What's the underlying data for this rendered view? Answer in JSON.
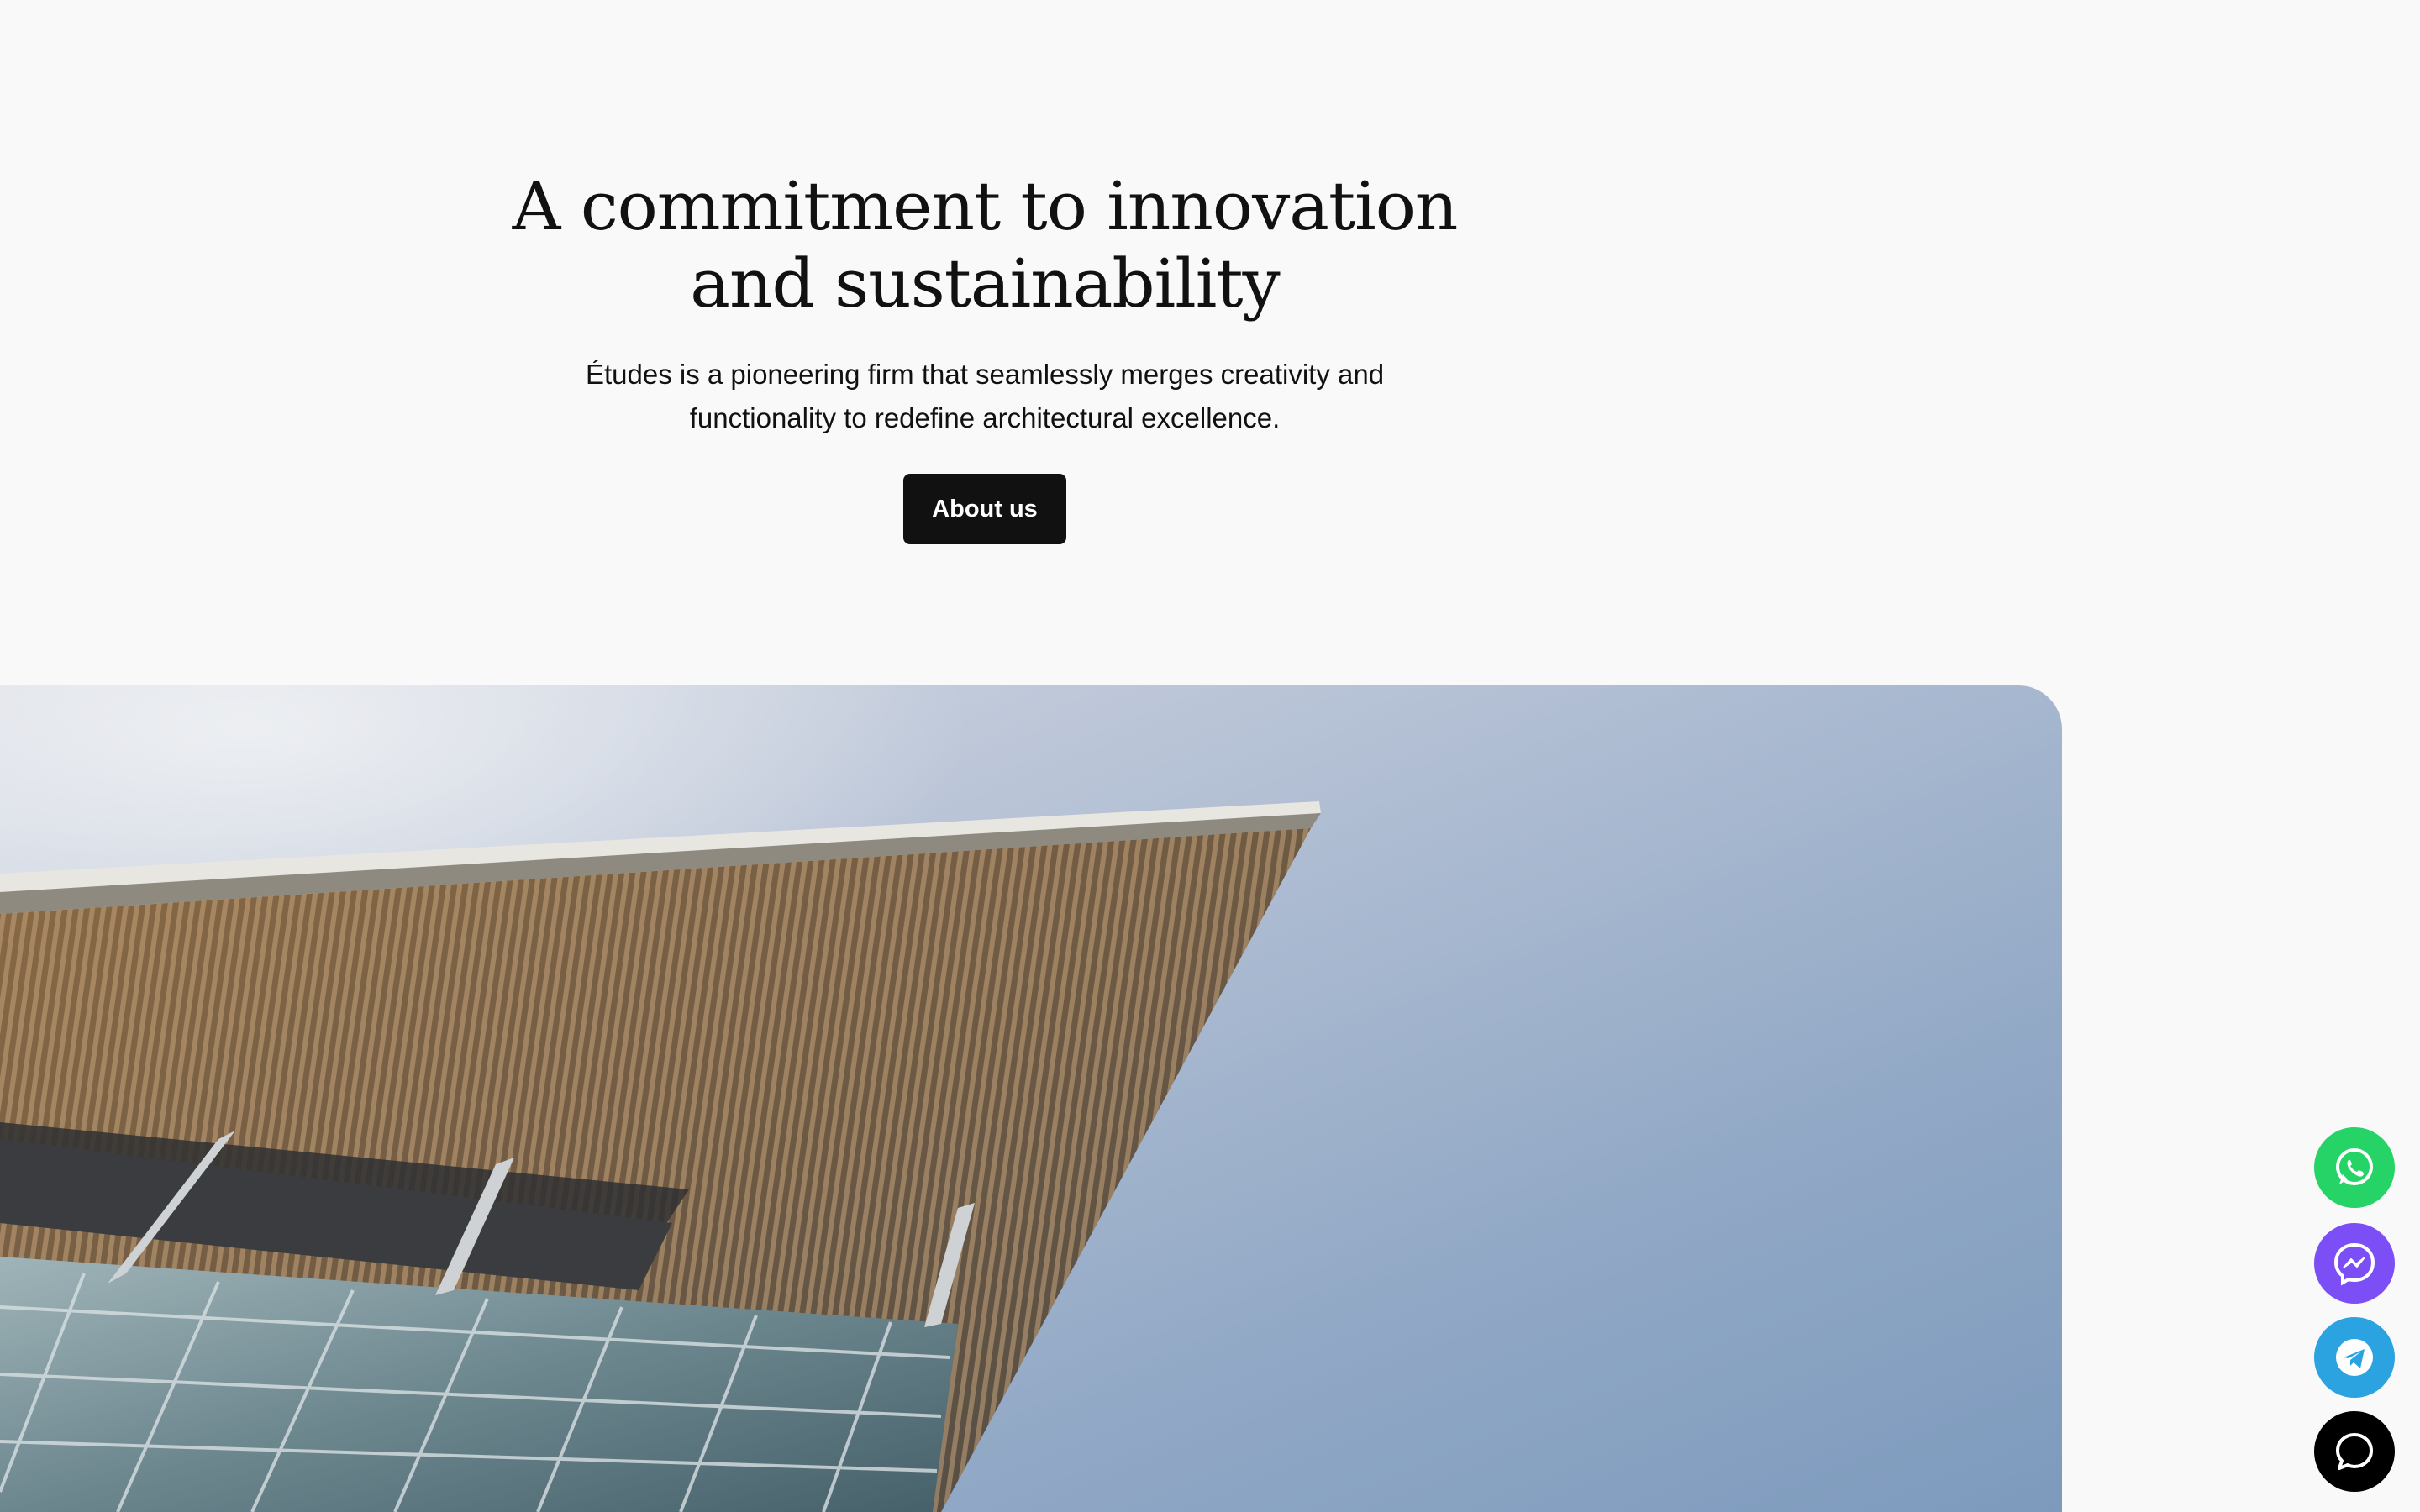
{
  "hero": {
    "title_line1": "A commitment to innovation",
    "title_line2": "and sustainability",
    "description": "Études is a pioneering firm that seamlessly merges creativity and functionality to redefine architectural excellence.",
    "cta_label": "About us"
  },
  "hero_image": {
    "subject": "modern-building-with-slatted-canopy-against-sky"
  },
  "floating_contacts": [
    {
      "icon": "whatsapp-icon",
      "color": "#25d366"
    },
    {
      "icon": "messenger-icon",
      "color": "#7b4ff5"
    },
    {
      "icon": "telegram-icon",
      "color": "#2aa3e0"
    },
    {
      "icon": "chat-icon",
      "color": "#000000"
    }
  ],
  "colors": {
    "background": "#f9f9f9",
    "text": "#111111",
    "button": "#111111",
    "button_text": "#ffffff"
  }
}
